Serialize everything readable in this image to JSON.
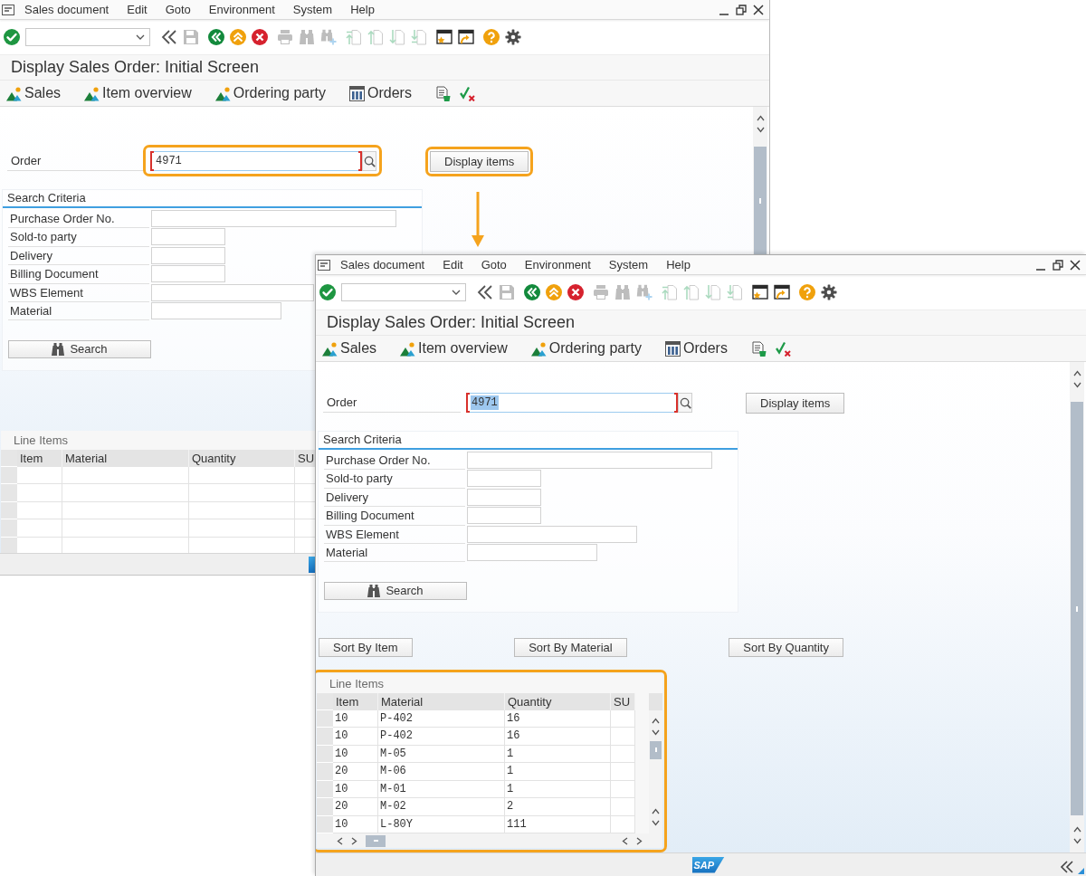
{
  "windows": [
    {
      "menu": [
        "Sales document",
        "Edit",
        "Goto",
        "Environment",
        "System",
        "Help"
      ],
      "toolbar": [
        [
          {
            "kind": "enter",
            "disabled": false
          },
          {
            "kind": "command",
            "disabled": false
          }
        ],
        [
          {
            "kind": "collapse",
            "disabled": false
          },
          {
            "kind": "save",
            "disabled": true
          }
        ],
        [
          {
            "kind": "back",
            "disabled": false
          },
          {
            "kind": "exit",
            "disabled": false
          },
          {
            "kind": "cancel",
            "disabled": false
          }
        ],
        [
          {
            "kind": "print",
            "disabled": true
          },
          {
            "kind": "find",
            "disabled": true
          },
          {
            "kind": "find_next",
            "disabled": true
          }
        ],
        [
          {
            "kind": "first_page",
            "disabled": true
          },
          {
            "kind": "previous_page",
            "disabled": true
          },
          {
            "kind": "next_page",
            "disabled": true
          },
          {
            "kind": "last_page",
            "disabled": true
          }
        ],
        [
          {
            "kind": "new_session",
            "disabled": false
          },
          {
            "kind": "shortcut",
            "disabled": false
          }
        ],
        [
          {
            "kind": "help",
            "disabled": false
          },
          {
            "kind": "settings",
            "disabled": false
          }
        ]
      ],
      "title": "Display Sales Order: Initial Screen",
      "app_toolbar": [
        {
          "kind": "mountain",
          "label": "Sales"
        },
        {
          "kind": "mountain",
          "label": "Item overview"
        },
        {
          "kind": "mountain",
          "label": "Ordering party"
        },
        {
          "kind": "columns",
          "label": "Orders"
        },
        {
          "kind": "document"
        },
        {
          "kind": "check_cross"
        }
      ],
      "order": {
        "label": "Order",
        "value": "4971",
        "focused": true,
        "text_selected": false,
        "highlighted": true
      },
      "display_button": {
        "label": "Display items",
        "highlighted": true
      },
      "search_criteria": {
        "title": "Search Criteria",
        "fields": [
          {
            "label": "Purchase Order No."
          },
          {
            "label": "Sold-to party"
          },
          {
            "label": "Delivery"
          },
          {
            "label": "Billing Document"
          },
          {
            "label": "WBS Element"
          },
          {
            "label": "Material"
          }
        ],
        "button": "Search"
      },
      "line_items": {
        "title": "Line Items",
        "highlighted": false,
        "columns": [
          "Item",
          "Material",
          "Quantity",
          "SU"
        ]
      },
      "status_bar": {
        "logo": true
      }
    },
    {
      "menu": [
        "Sales document",
        "Edit",
        "Goto",
        "Environment",
        "System",
        "Help"
      ],
      "toolbar": [
        [
          {
            "kind": "enter",
            "disabled": false
          },
          {
            "kind": "command",
            "disabled": false
          }
        ],
        [
          {
            "kind": "collapse",
            "disabled": false
          },
          {
            "kind": "save",
            "disabled": true
          }
        ],
        [
          {
            "kind": "back",
            "disabled": false
          },
          {
            "kind": "exit",
            "disabled": false
          },
          {
            "kind": "cancel",
            "disabled": false
          }
        ],
        [
          {
            "kind": "print",
            "disabled": true
          },
          {
            "kind": "find",
            "disabled": true
          },
          {
            "kind": "find_next",
            "disabled": true
          }
        ],
        [
          {
            "kind": "first_page",
            "disabled": true
          },
          {
            "kind": "previous_page",
            "disabled": true
          },
          {
            "kind": "next_page",
            "disabled": true
          },
          {
            "kind": "last_page",
            "disabled": true
          }
        ],
        [
          {
            "kind": "new_session",
            "disabled": false
          },
          {
            "kind": "shortcut",
            "disabled": false
          }
        ],
        [
          {
            "kind": "help",
            "disabled": false
          },
          {
            "kind": "settings",
            "disabled": false
          }
        ]
      ],
      "title": "Display Sales Order: Initial Screen",
      "app_toolbar": [
        {
          "kind": "mountain",
          "label": "Sales"
        },
        {
          "kind": "mountain",
          "label": "Item overview"
        },
        {
          "kind": "mountain",
          "label": "Ordering party"
        },
        {
          "kind": "columns",
          "label": "Orders"
        },
        {
          "kind": "document"
        },
        {
          "kind": "check_cross"
        }
      ],
      "order": {
        "label": "Order",
        "value": "4971",
        "focused": true,
        "text_selected": true,
        "highlighted": false
      },
      "display_button": {
        "label": "Display items",
        "highlighted": false
      },
      "search_criteria": {
        "title": "Search Criteria",
        "fields": [
          {
            "label": "Purchase Order No."
          },
          {
            "label": "Sold-to party"
          },
          {
            "label": "Delivery"
          },
          {
            "label": "Billing Document"
          },
          {
            "label": "WBS Element"
          },
          {
            "label": "Material"
          }
        ],
        "button": "Search"
      },
      "sort_buttons": [
        "Sort By Item",
        "Sort By Material",
        "Sort By Quantity"
      ],
      "line_items": {
        "title": "Line Items",
        "highlighted": true,
        "columns": [
          "Item",
          "Material",
          "Quantity",
          "SU"
        ],
        "rows": [
          [
            "10",
            "P-402",
            "16"
          ],
          [
            "10",
            "P-402",
            "16"
          ],
          [
            "10",
            "M-05",
            "1"
          ],
          [
            "20",
            "M-06",
            "1"
          ],
          [
            "10",
            "M-01",
            "1"
          ],
          [
            "20",
            "M-02",
            "2"
          ],
          [
            "10",
            "L-80Y",
            "111"
          ]
        ]
      },
      "status_bar": {
        "logo": true,
        "logo_text": "SAP"
      }
    }
  ]
}
